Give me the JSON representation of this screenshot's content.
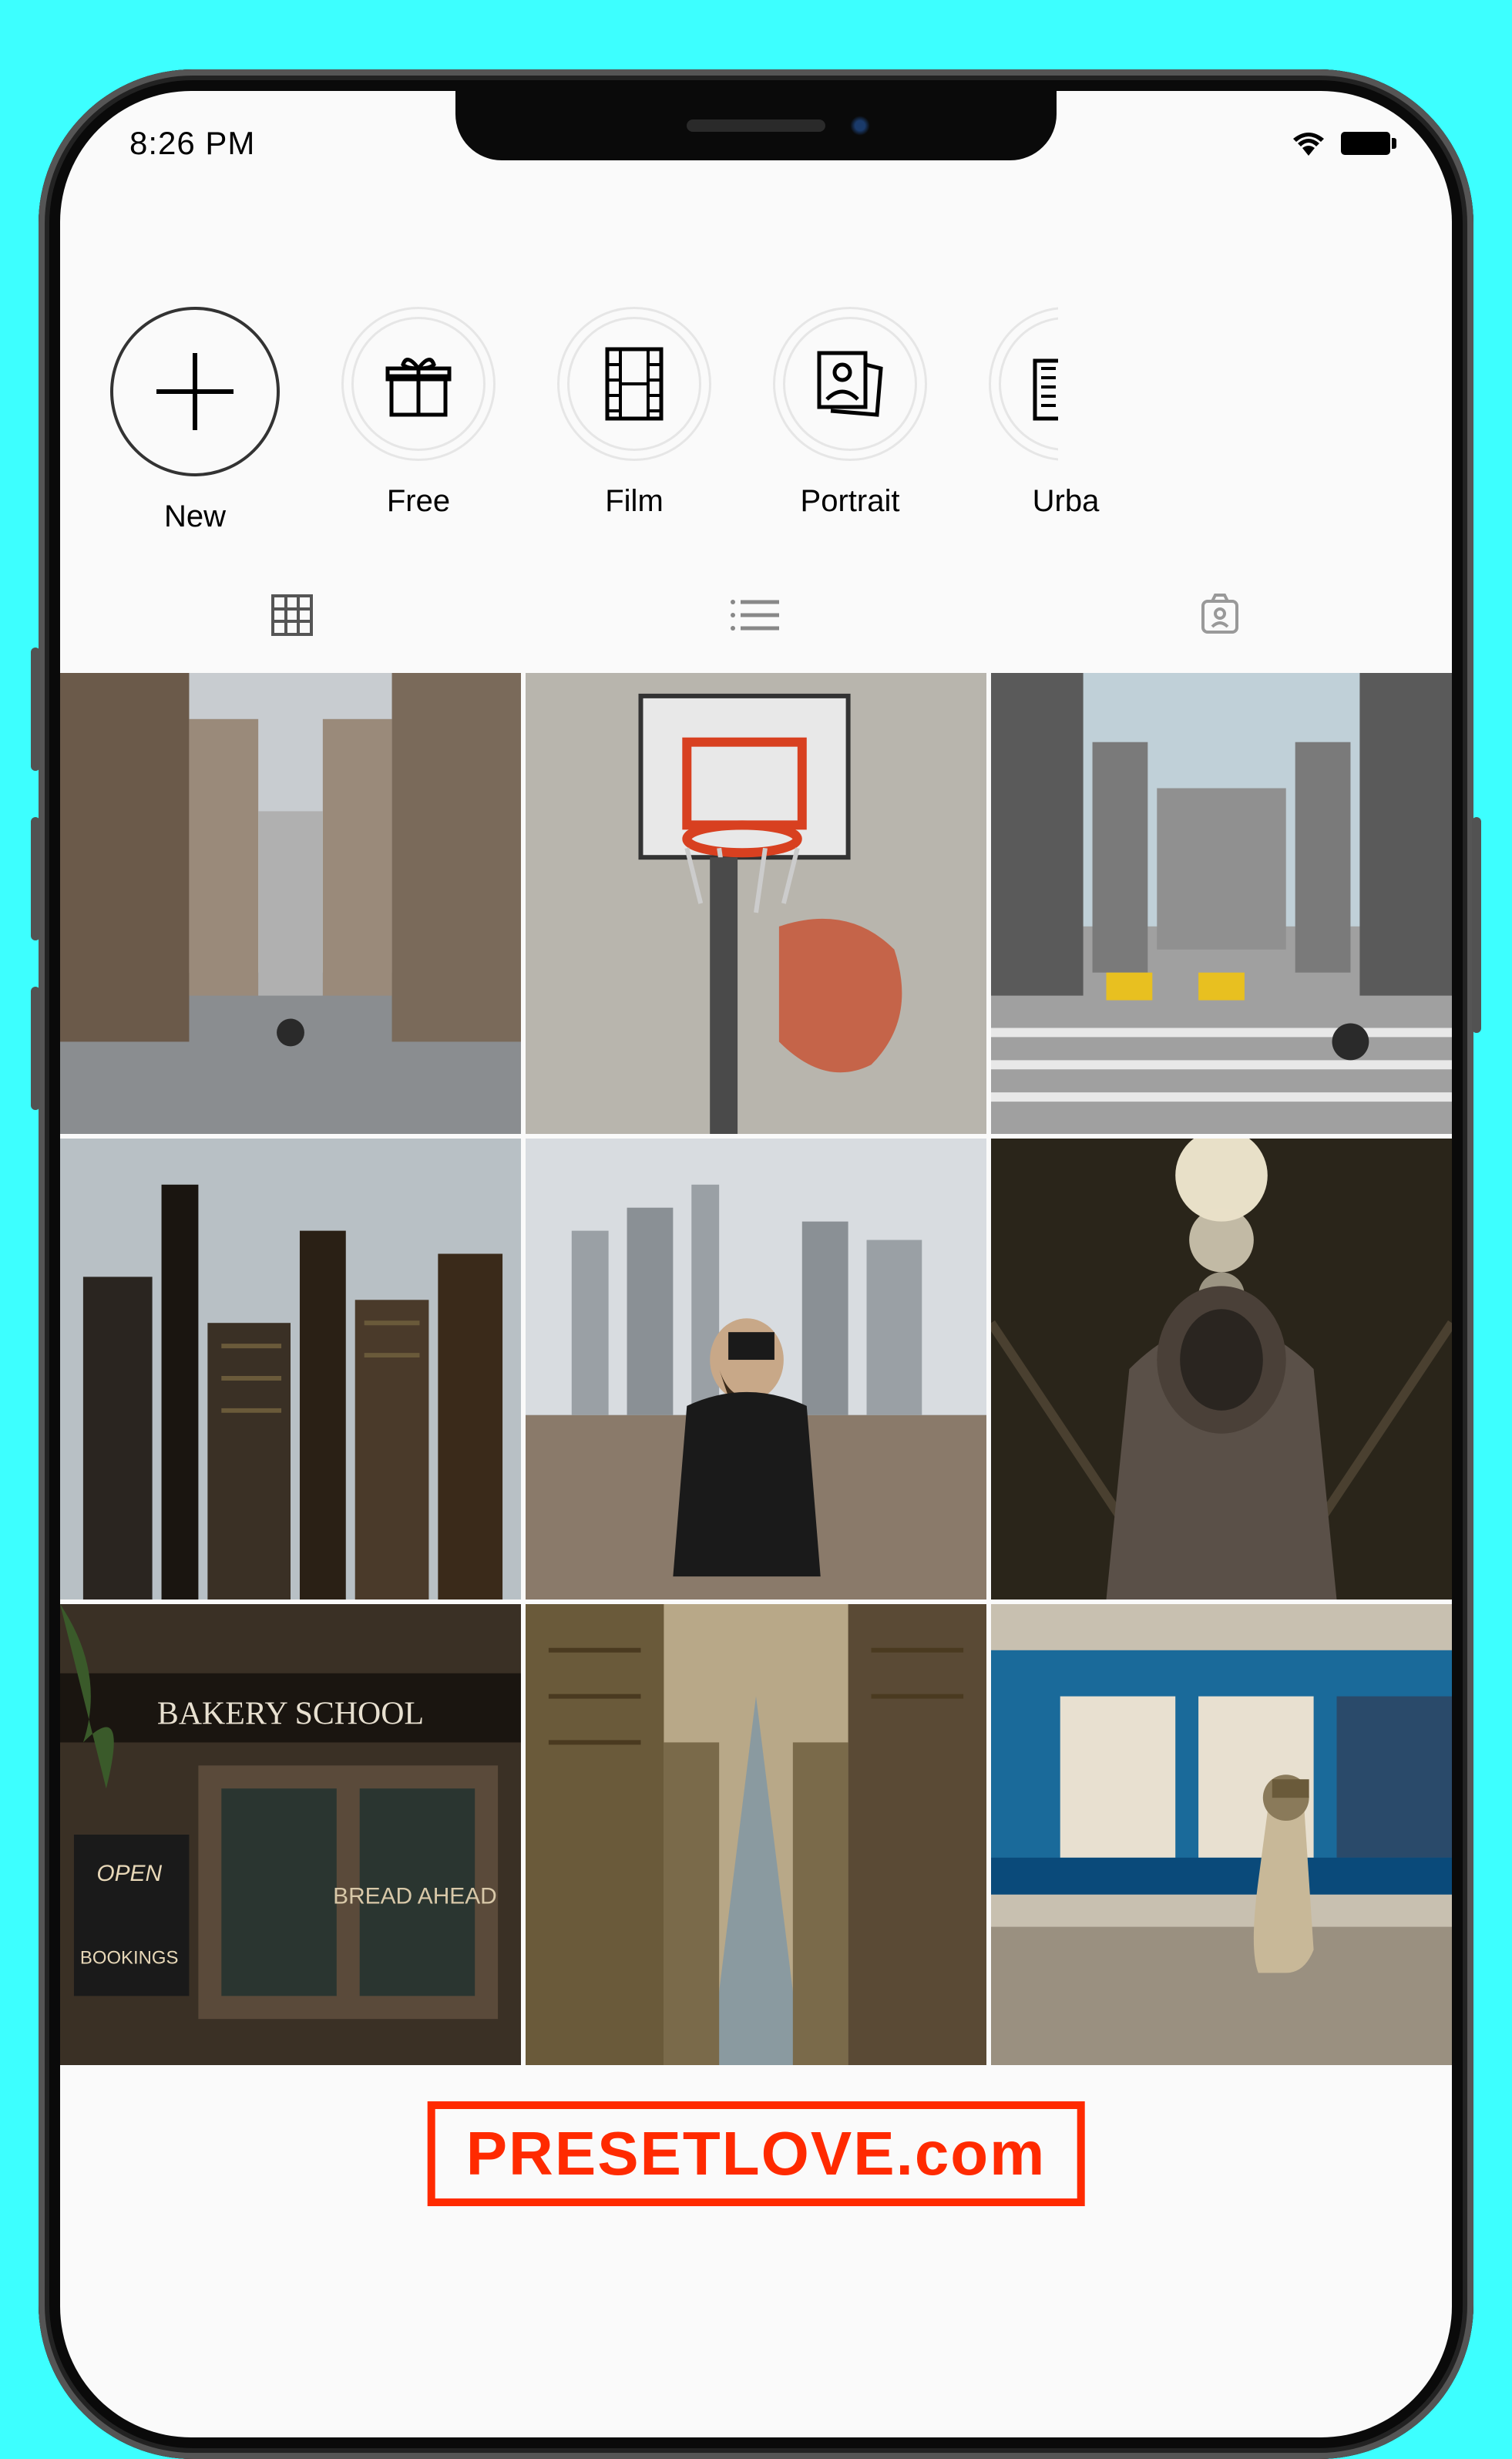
{
  "statusbar": {
    "time": "8:26 PM"
  },
  "highlights": [
    {
      "id": "new-highlight",
      "label": "New",
      "icon": "plus-icon"
    },
    {
      "id": "free-highlight",
      "label": "Free",
      "icon": "gift-icon"
    },
    {
      "id": "film-highlight",
      "label": "Film",
      "icon": "film-icon"
    },
    {
      "id": "portrait-highlight",
      "label": "Portrait",
      "icon": "portrait-icon"
    },
    {
      "id": "urban-highlight",
      "label": "Urba",
      "icon": "buildings-icon"
    }
  ],
  "tabs": {
    "grid_view": "grid-view-icon",
    "list_view": "list-view-icon",
    "tagged_view": "tagged-view-icon"
  },
  "feed_items": [
    {
      "name": "thumb-city-street-1"
    },
    {
      "name": "thumb-basketball-hoop"
    },
    {
      "name": "thumb-city-avenue"
    },
    {
      "name": "thumb-skyline-dark"
    },
    {
      "name": "thumb-man-skyline"
    },
    {
      "name": "thumb-hooded-figure"
    },
    {
      "name": "thumb-bakery-shop"
    },
    {
      "name": "thumb-downtown-view"
    },
    {
      "name": "thumb-train-station"
    }
  ],
  "watermark": "PRESETLOVE.com"
}
